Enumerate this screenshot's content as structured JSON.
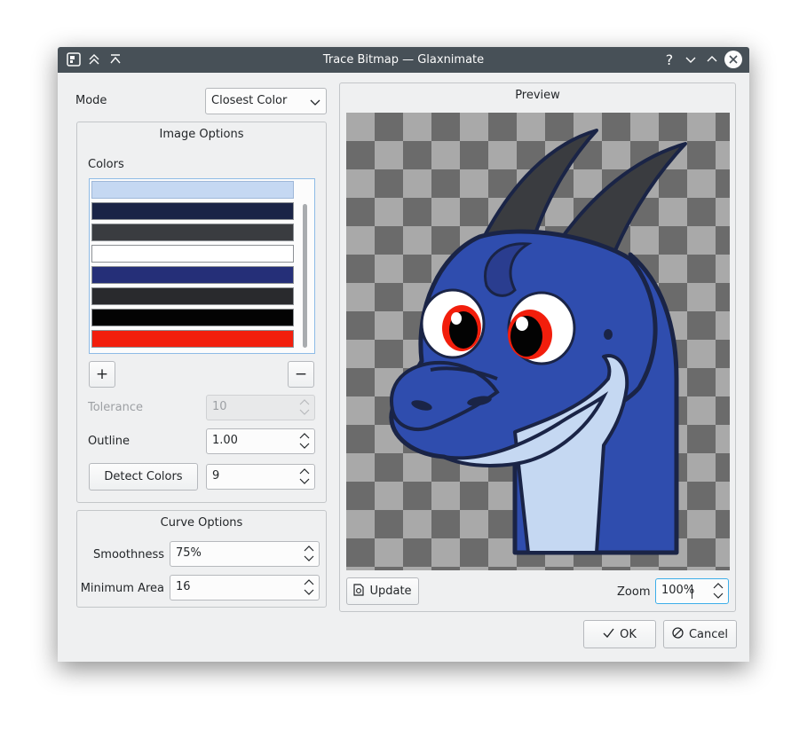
{
  "window": {
    "title": "Trace Bitmap — Glaxnimate"
  },
  "mode": {
    "label": "Mode",
    "value": "Closest Color"
  },
  "image_options": {
    "title": "Image Options",
    "colors_label": "Colors",
    "colors": [
      "#c5d8f2",
      "#1a2446",
      "#3a3c40",
      "#ffffff",
      "#252f78",
      "#292a2d",
      "#030303",
      "#f21e0c"
    ],
    "add_label": "+",
    "remove_label": "−",
    "tolerance": {
      "label": "Tolerance",
      "value": "10"
    },
    "outline": {
      "label": "Outline",
      "value": "1.00"
    },
    "detect_colors_label": "Detect Colors",
    "detect_count": "9"
  },
  "curve_options": {
    "title": "Curve Options",
    "smoothness": {
      "label": "Smoothness",
      "value": "75%"
    },
    "minimum_area": {
      "label": "Minimum Area",
      "value": "16"
    }
  },
  "preview": {
    "title": "Preview",
    "update_label": "Update",
    "zoom_label": "Zoom",
    "zoom_value": "100%"
  },
  "footer": {
    "ok_label": "OK",
    "cancel_label": "Cancel"
  },
  "icons": {
    "app": "glaxnimate-app-icon",
    "help": "help-icon",
    "minimize": "minimize-icon",
    "maximize": "maximize-icon",
    "close": "close-icon"
  }
}
